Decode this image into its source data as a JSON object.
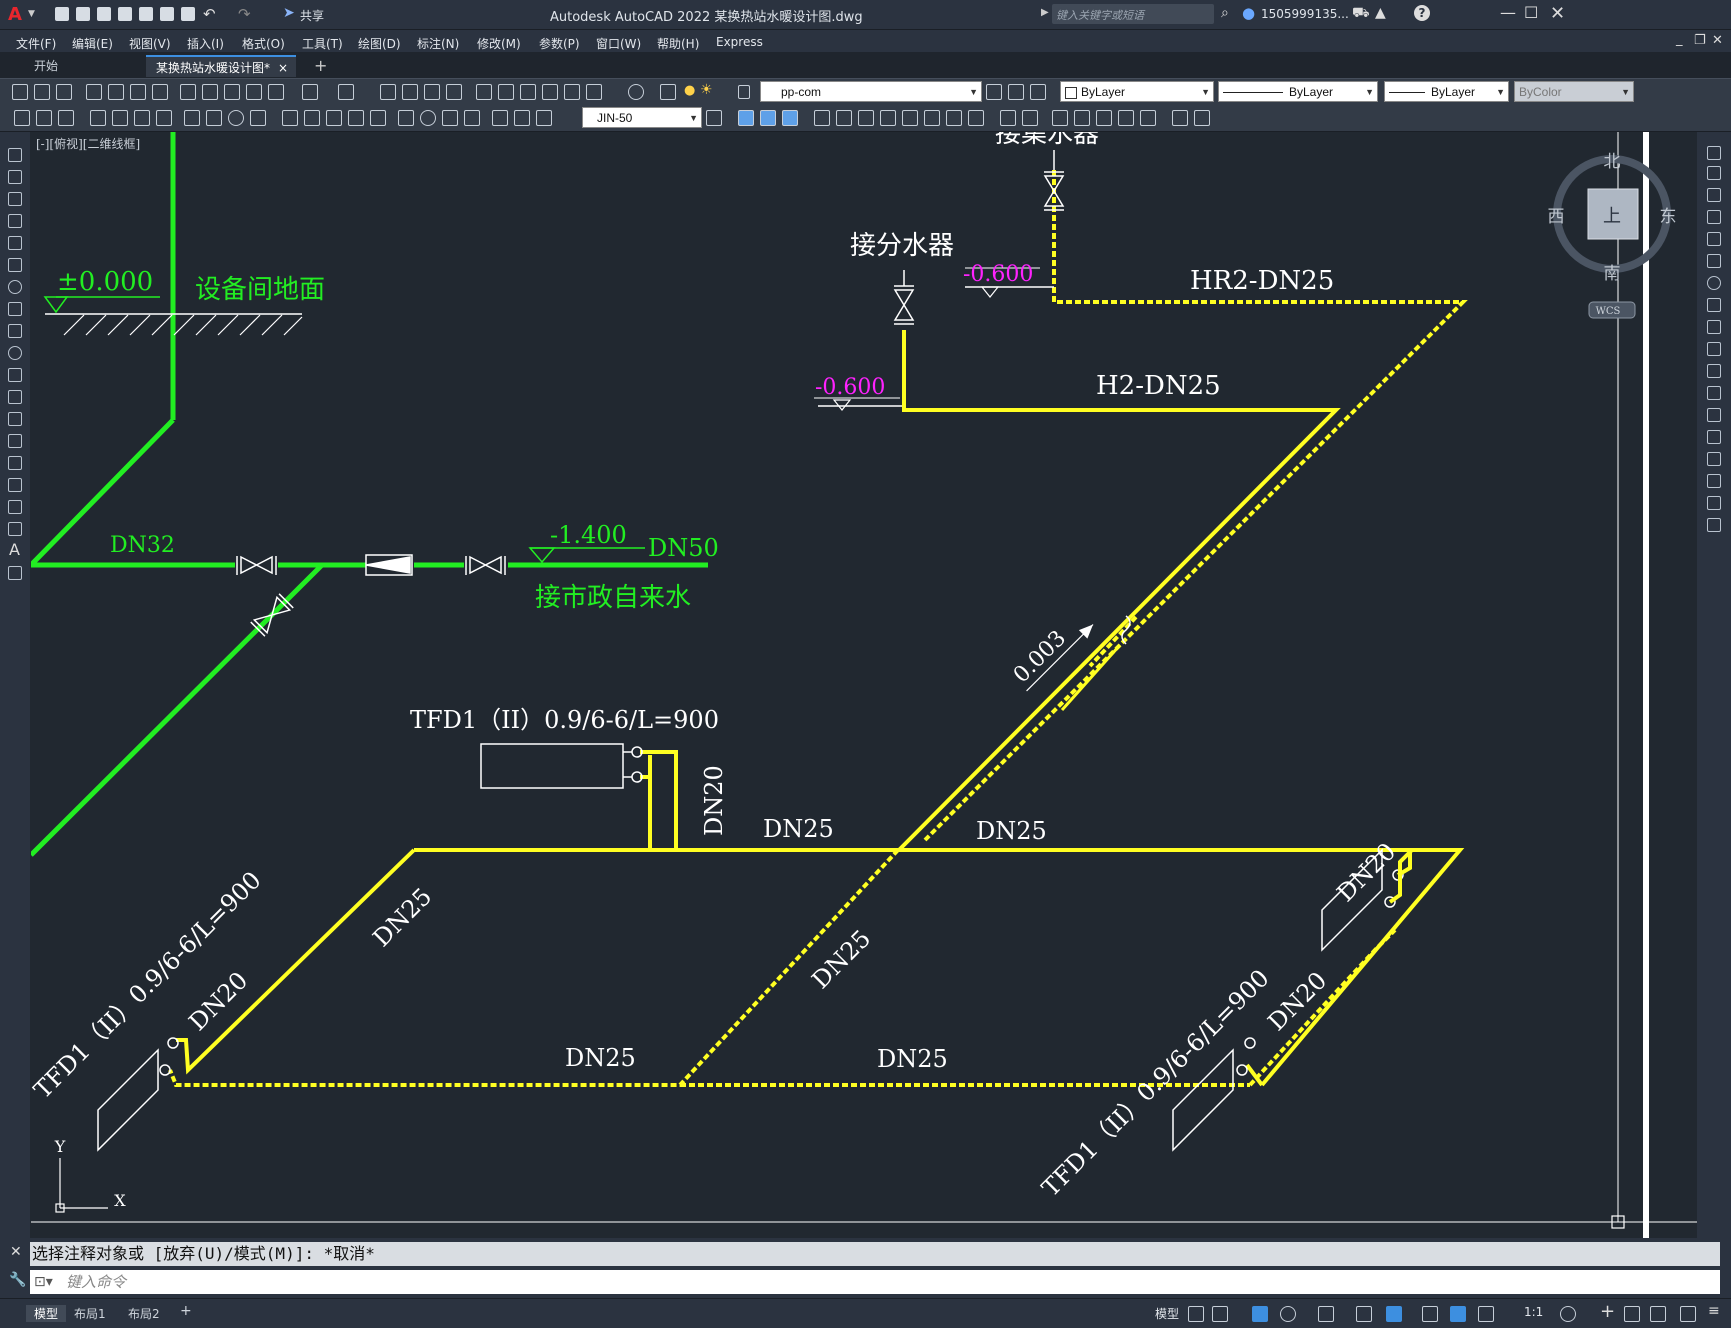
{
  "app": {
    "title": "Autodesk AutoCAD 2022    某换热站水暖设计图.dwg",
    "share_label": "共享",
    "search_placeholder": "键入关键字或短语",
    "user": "1505999135...",
    "logo": "A"
  },
  "menu": [
    "文件(F)",
    "编辑(E)",
    "视图(V)",
    "插入(I)",
    "格式(O)",
    "工具(T)",
    "绘图(D)",
    "标注(N)",
    "修改(M)",
    "参数(P)",
    "窗口(W)",
    "帮助(H)",
    "Express"
  ],
  "tabs": {
    "start": "开始",
    "file": "某换热站水暖设计图*",
    "close": "×",
    "add": "+"
  },
  "toolbar": {
    "layer": "pp-com",
    "color": "ByLayer",
    "linetype": "ByLayer",
    "lineweight": "ByLayer",
    "plotstyle": "ByColor",
    "dimstyle": "JIN-50"
  },
  "viewport_label": "[-][俯视][二维线框]",
  "viewcube": {
    "north": "北",
    "south": "南",
    "east": "东",
    "west": "西",
    "face": "上",
    "wcs": "WCS"
  },
  "ucs": {
    "x": "X",
    "y": "Y"
  },
  "drawing": {
    "elevation_zero": "±0.000",
    "floor_label": "设备间地面",
    "dn32": "DN32",
    "dn50": "DN50",
    "elev_1400": "-1.400",
    "municipal_water": "接市政自来水",
    "collector_label": "接集水器",
    "distributor_label": "接分水器",
    "elev_0600_a": "-0.600",
    "elev_0600_b": "-0.600",
    "hr2": "HR2-DN25",
    "h2": "H2-DN25",
    "slope": "0.003",
    "radiator_top": "TFD1（II）0.9/6-6/L=900",
    "radiator_left": "TFD1（II）0.9/6-6/L=900",
    "radiator_right": "TFD1（II）0.9/6-6/L=900",
    "dn20_top": "DN20",
    "dn20_left": "DN20",
    "dn20_right_a": "DN20",
    "dn20_right_b": "DN20",
    "dn25_a": "DN25",
    "dn25_b": "DN25",
    "dn25_c": "DN25",
    "dn25_d": "DN25",
    "dn25_e": "DN25",
    "dn25_f": "DN25"
  },
  "command": {
    "history": "选择注释对象或 [放弃(U)/模式(M)]: *取消*",
    "placeholder": "键入命令"
  },
  "status": {
    "model_tab": "模型",
    "layout1": "布局1",
    "layout2": "布局2",
    "model_btn": "模型",
    "scale": "1:1"
  },
  "colors": {
    "green": "#22ee22",
    "yellow": "#ffff22",
    "magenta": "#ff22ff",
    "white": "#ffffff",
    "background": "#212830"
  }
}
